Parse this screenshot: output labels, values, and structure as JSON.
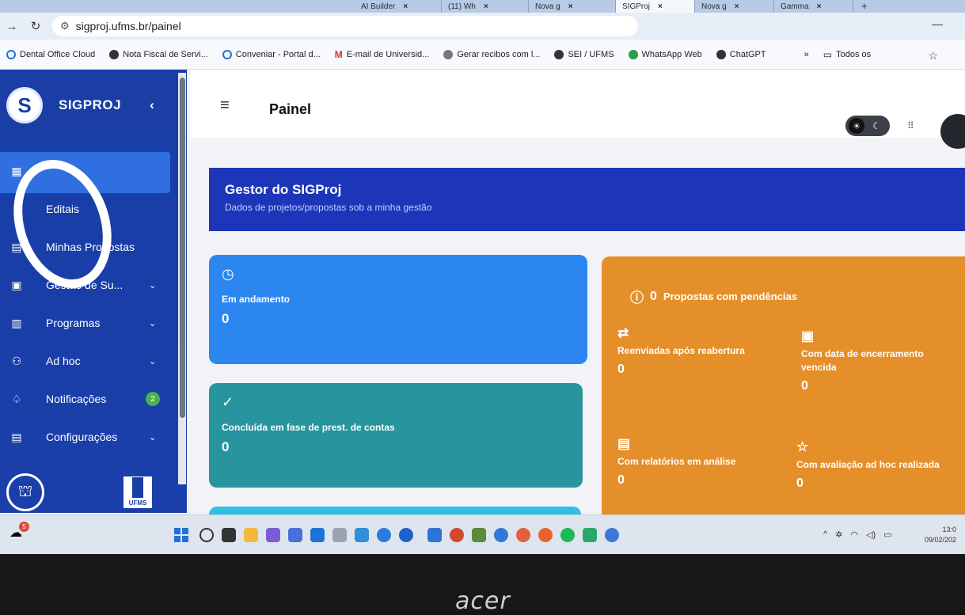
{
  "browser": {
    "tabs": [
      {
        "label": "AI Builder",
        "active": false
      },
      {
        "label": "(11) Wh",
        "active": false
      },
      {
        "label": "Nova g",
        "active": false
      },
      {
        "label": "SIGProj",
        "active": true
      },
      {
        "label": "Nova g",
        "active": false
      },
      {
        "label": "Gamma",
        "active": false
      }
    ],
    "new_tab": "+",
    "url": "sigproj.ufms.br/painel",
    "bookmarks": [
      {
        "label": "Dental Office Cloud",
        "color": "#1e73d8"
      },
      {
        "label": "Nota Fiscal de Servi...",
        "color": "#333333"
      },
      {
        "label": "Conveniar - Portal d...",
        "color": "#1e73d8"
      },
      {
        "label": "E-mail de Universid...",
        "color": "#d93025"
      },
      {
        "label": "Gerar recibos com l...",
        "color": "#555555"
      },
      {
        "label": "SEI / UFMS",
        "color": "#333333"
      },
      {
        "label": "WhatsApp Web",
        "color": "#25a244"
      },
      {
        "label": "ChatGPT",
        "color": "#333333"
      }
    ],
    "overflow": "»",
    "all_bookmarks": "Todos os"
  },
  "sidebar": {
    "brand": "SIGPROJ",
    "collapse": "‹",
    "items": [
      {
        "label": "",
        "icon": "dashboard-icon",
        "glyph": "▦",
        "chevron": "",
        "active": true
      },
      {
        "label": "Editais",
        "icon": "document-icon",
        "glyph": "",
        "chevron": "",
        "active": false
      },
      {
        "label": "Minhas Propostas",
        "icon": "proposals-icon",
        "glyph": "▤",
        "chevron": "",
        "active": false
      },
      {
        "label": "Gestão de Su...",
        "icon": "file-icon",
        "glyph": "▣",
        "chevron": "⌄",
        "active": false
      },
      {
        "label": "Programas",
        "icon": "list-icon",
        "glyph": "▥",
        "chevron": "⌄",
        "active": false
      },
      {
        "label": "Ad hoc",
        "icon": "users-icon",
        "glyph": "⚇",
        "chevron": "⌄",
        "active": false
      },
      {
        "label": "Notificações",
        "icon": "bell-icon",
        "glyph": "♤",
        "chevron": "",
        "badge": "2",
        "active": false
      },
      {
        "label": "Configurações",
        "icon": "settings-icon",
        "glyph": "▤",
        "chevron": "⌄",
        "active": false
      }
    ],
    "footer_logo": "UFMS"
  },
  "header": {
    "menu_glyph": "≡",
    "title": "Painel"
  },
  "gestor": {
    "title": "Gestor do SIGProj",
    "subtitle": "Dados de projetos/propostas sob a minha gestão"
  },
  "cards": {
    "andamento": {
      "label": "Em andamento",
      "value": "0"
    },
    "concluida": {
      "label": "Concluída em fase de prest. de contas",
      "value": "0"
    },
    "pendencias": {
      "count": "0",
      "label": "Propostas com pendências",
      "items": [
        {
          "label": "Reenviadas após reabertura",
          "value": "0",
          "glyph": "⇄"
        },
        {
          "label": "Com data de encerramento vencida",
          "value": "0",
          "glyph": "▣"
        },
        {
          "label": "Com relatórios em análise",
          "value": "0",
          "glyph": "▤"
        },
        {
          "label": "Com avaliação ad hoc realizada",
          "value": "0",
          "glyph": "☆"
        }
      ]
    }
  },
  "taskbar": {
    "notification_count": "5",
    "clock_time": "13:0",
    "clock_date": "09/02/202"
  },
  "laptop_brand": "acer",
  "colors": {
    "sidebar": "#1a3ea6",
    "active_item": "#2f6fe0",
    "gestor_banner": "#1d35b8",
    "andamento": "#2b86f0",
    "concluida": "#27949e",
    "pendencias": "#e58f2a"
  }
}
